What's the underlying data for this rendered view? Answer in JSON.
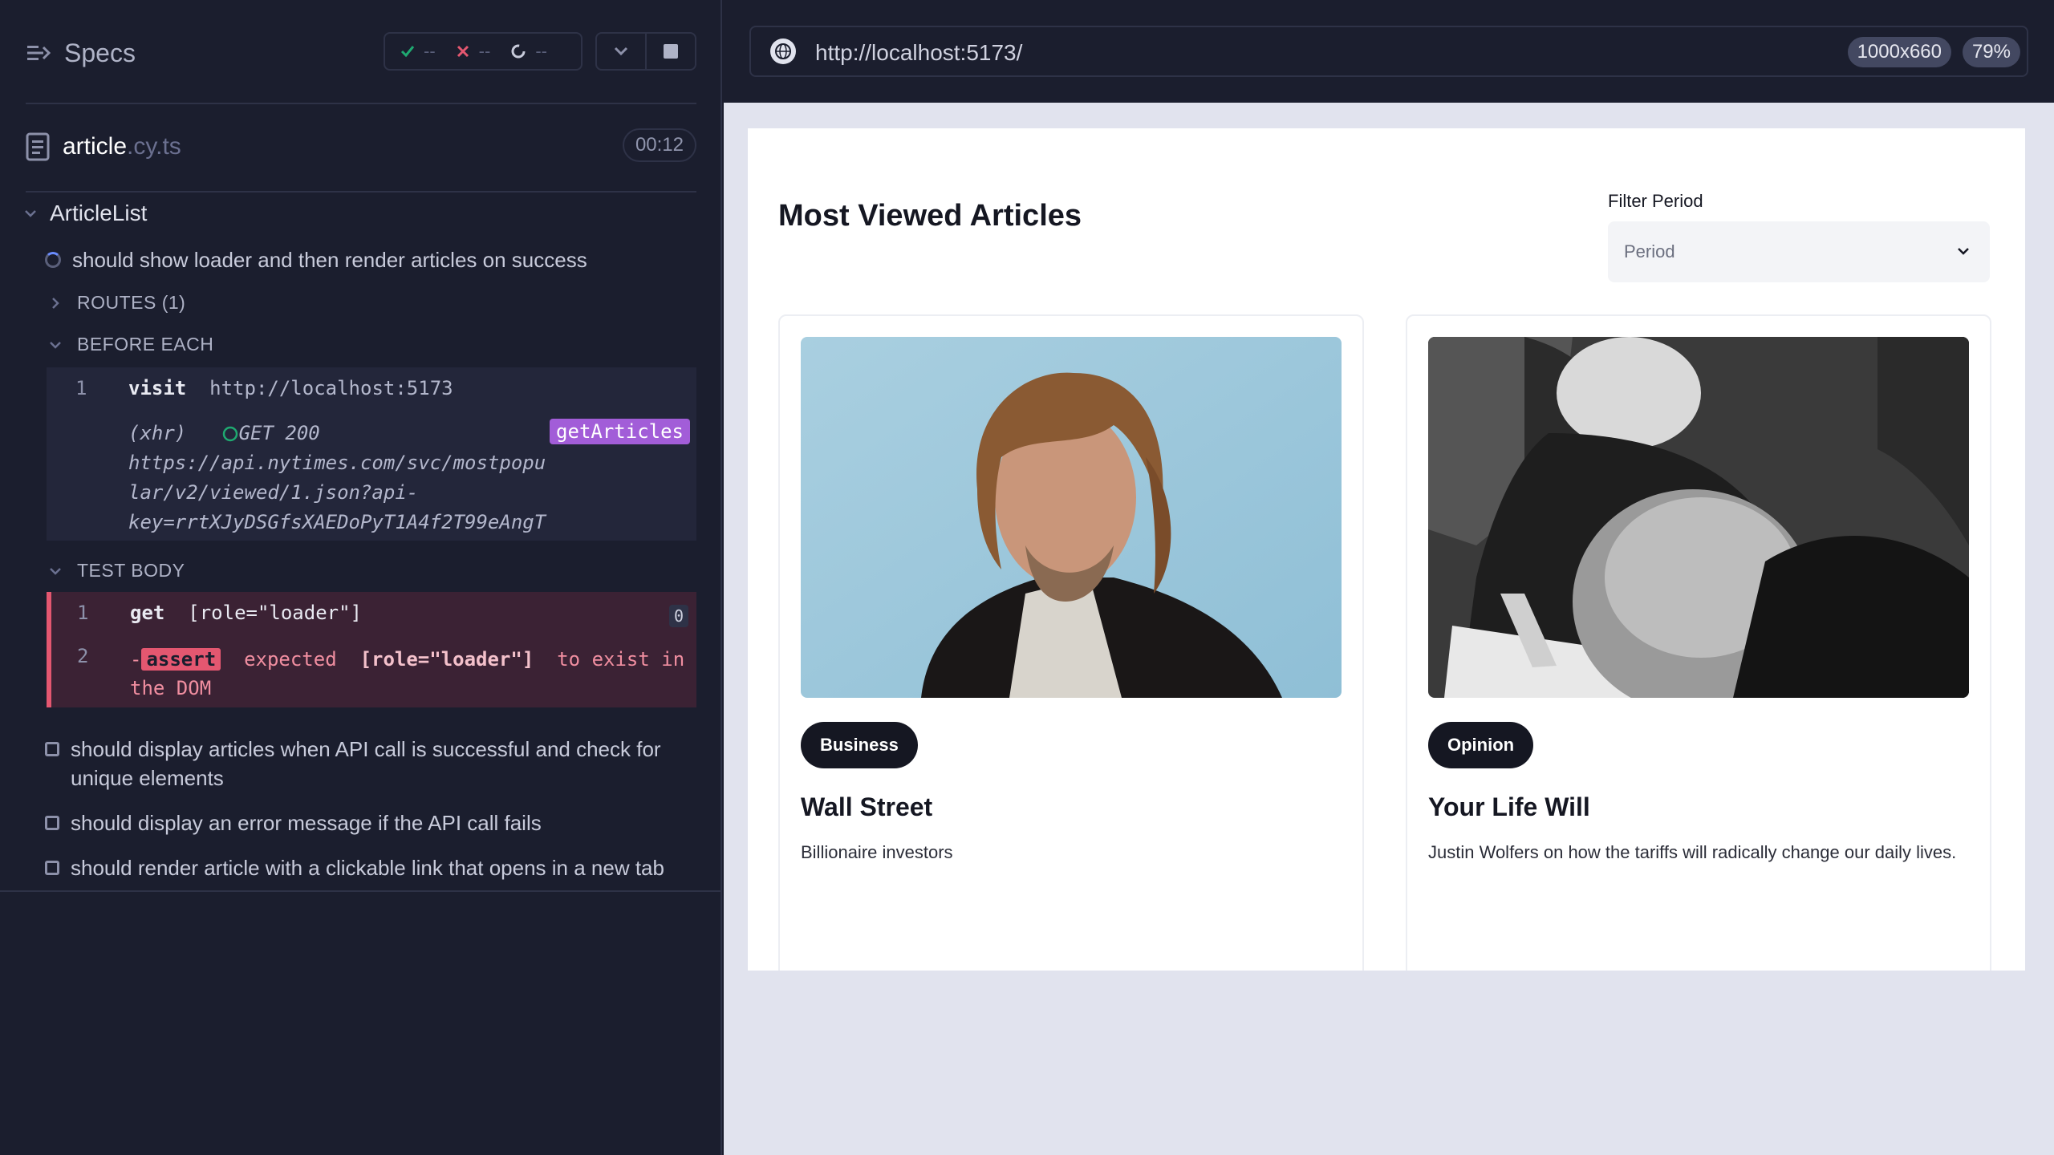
{
  "reporter": {
    "specs_title": "Specs",
    "stats": {
      "passed": "--",
      "failed": "--",
      "pending": "--"
    },
    "spec_file": {
      "name": "article",
      "ext": ".cy.ts",
      "duration": "00:12"
    },
    "suite_title": "ArticleList",
    "active_test": "should show loader and then render articles on success",
    "routes_label": "ROUTES (1)",
    "before_each_label": "BEFORE EACH",
    "visit": {
      "num": "1",
      "command": "visit",
      "url": "http://localhost:5173"
    },
    "xhr": {
      "tag": "(xhr)",
      "status": "GET 200",
      "url_line1": "https://api.nytimes.com/svc/mostpopu",
      "url_line2": "lar/v2/viewed/1.json?api-",
      "url_line3": "key=rrtXJyDSGfsXAEDoPyT1A4f2T99eAngT",
      "alias": "getArticles"
    },
    "test_body_label": "TEST BODY",
    "get_cmd": {
      "num": "1",
      "command": "get",
      "selector": "[role=\"loader\"]",
      "count": "0"
    },
    "assert_cmd": {
      "num": "2",
      "prefix": "-",
      "badge": "assert",
      "expected": "expected",
      "selector": "[role=\"loader\"]",
      "tail_line1": "to exist in",
      "tail_line2": "the DOM"
    },
    "other_tests": [
      {
        "line1": "should display articles when API call is successful and check for",
        "line2": "unique elements"
      },
      {
        "line1": "should display an error message if the API call fails",
        "line2": ""
      },
      {
        "line1": "should render article with a clickable link that opens in a new tab",
        "line2": ""
      }
    ]
  },
  "aut": {
    "url": "http://localhost:5173/",
    "viewport_size": "1000x660",
    "zoom": "79%",
    "page": {
      "title": "Most Viewed Articles",
      "filter_label": "Filter Period",
      "filter_value": "Period",
      "cards": [
        {
          "badge": "Business",
          "title": "Wall Street",
          "desc": "Billionaire investors"
        },
        {
          "badge": "Opinion",
          "title": "Your Life Will",
          "desc": "Justin Wolfers on how the tariffs will radically change our daily lives."
        }
      ]
    }
  },
  "colors": {
    "reporter_bg": "#1b1e2e",
    "aut_bg": "#e1e3ee",
    "fail_accent": "#e45770",
    "alias_purple": "#a25dd8",
    "pass_green": "#1fa971"
  }
}
